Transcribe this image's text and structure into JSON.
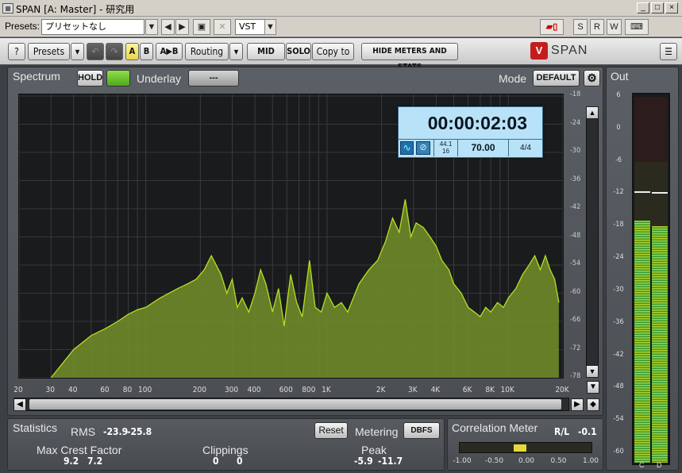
{
  "window": {
    "title": "SPAN [A: Master] - 研究用",
    "min_label": "_",
    "max_label": "□",
    "close_label": "×"
  },
  "host": {
    "presets_label": "Presets:",
    "preset_value": "プリセットなし",
    "vst_label": "VST",
    "s_label": "S",
    "r_label": "R",
    "w_label": "W"
  },
  "toolbar": {
    "help": "?",
    "presets": "Presets",
    "a": "A",
    "b": "B",
    "ab": "A▶B",
    "routing": "Routing",
    "mid": "MID",
    "solo": "SOLO",
    "copy_to": "Copy to",
    "hide_meters": "HIDE METERS AND STATS",
    "brand": "SPAN"
  },
  "spectrum": {
    "title": "Spectrum",
    "hold": "HOLD",
    "underlay_label": "Underlay",
    "underlay_value": "---",
    "mode_label": "Mode",
    "mode_value": "DEFAULT",
    "time": "00:00:02:03",
    "samplerate": "44.1",
    "bitdepth": "16",
    "tempo": "70.00",
    "signature": "4/4",
    "db_ticks": [
      "-18",
      "-24",
      "-30",
      "-36",
      "-42",
      "-48",
      "-54",
      "-60",
      "-66",
      "-72",
      "-78"
    ],
    "freq_ticks": [
      {
        "f": 20,
        "label": "20"
      },
      {
        "f": 30,
        "label": "30"
      },
      {
        "f": 40,
        "label": "40"
      },
      {
        "f": 60,
        "label": "60"
      },
      {
        "f": 80,
        "label": "80"
      },
      {
        "f": 100,
        "label": "100"
      },
      {
        "f": 200,
        "label": "200"
      },
      {
        "f": 300,
        "label": "300"
      },
      {
        "f": 400,
        "label": "400"
      },
      {
        "f": 600,
        "label": "600"
      },
      {
        "f": 800,
        "label": "800"
      },
      {
        "f": 1000,
        "label": "1K"
      },
      {
        "f": 2000,
        "label": "2K"
      },
      {
        "f": 3000,
        "label": "3K"
      },
      {
        "f": 4000,
        "label": "4K"
      },
      {
        "f": 6000,
        "label": "6K"
      },
      {
        "f": 8000,
        "label": "8K"
      },
      {
        "f": 10000,
        "label": "10K"
      },
      {
        "f": 20000,
        "label": "20K"
      }
    ],
    "fill_color": "#6f8a2a",
    "line_color": "#b5e022"
  },
  "chart_data": {
    "type": "area",
    "xscale": "log",
    "xlim": [
      20,
      20000
    ],
    "ylim": [
      -78,
      -18
    ],
    "x": [
      30,
      40,
      50,
      60,
      70,
      80,
      90,
      100,
      120,
      150,
      170,
      190,
      210,
      230,
      260,
      280,
      300,
      320,
      340,
      370,
      400,
      430,
      460,
      500,
      540,
      580,
      630,
      680,
      730,
      800,
      860,
      930,
      1000,
      1100,
      1200,
      1300,
      1500,
      1700,
      1900,
      2100,
      2300,
      2500,
      2700,
      2900,
      3100,
      3400,
      3700,
      4000,
      4300,
      4700,
      5000,
      5500,
      6000,
      6500,
      7000,
      7500,
      8000,
      8700,
      9400,
      10000,
      11000,
      12000,
      13000,
      14000,
      15000,
      16000,
      17000,
      18000,
      19000
    ],
    "values": [
      -78,
      -72,
      -69,
      -67.5,
      -66,
      -64.5,
      -63.5,
      -63,
      -61,
      -59,
      -58,
      -57,
      -55,
      -52,
      -56,
      -60,
      -57,
      -63,
      -61,
      -64,
      -60,
      -55,
      -58,
      -64,
      -59,
      -67,
      -56,
      -62,
      -65,
      -53,
      -63,
      -64,
      -60,
      -63,
      -62,
      -64,
      -58,
      -55,
      -53,
      -49,
      -44,
      -47,
      -40,
      -48,
      -45,
      -46,
      -48,
      -50,
      -53,
      -55,
      -58,
      -60,
      -63,
      -64,
      -65,
      -63,
      -64,
      -62,
      -63,
      -61,
      -59,
      -56,
      -54,
      -52,
      -55,
      -52,
      -55,
      -57,
      -62
    ]
  },
  "stats": {
    "title": "Statistics",
    "rms_label": "RMS",
    "rms_l": "-23.9",
    "rms_r": "-25.8",
    "reset": "Reset",
    "metering_label": "Metering",
    "metering_value": "DBFS",
    "crest_label": "Max Crest Factor",
    "crest_l": "9.2",
    "crest_r": "7.2",
    "clip_label": "Clippings",
    "clip_l": "0",
    "clip_r": "0",
    "peak_label": "Peak",
    "peak_l": "-5.9",
    "peak_r": "-11.7"
  },
  "correlation": {
    "title": "Correlation Meter",
    "mode": "R/L",
    "value": "-0.1",
    "ticks": [
      "-1.00",
      "-0.50",
      "0.00",
      "0.50",
      "1.00"
    ],
    "level": -0.1
  },
  "out": {
    "title": "Out",
    "ticks": [
      "6",
      "0",
      "-6",
      "-12",
      "-18",
      "-24",
      "-30",
      "-36",
      "-42",
      "-48",
      "-54",
      "-60"
    ],
    "channel_l": "C",
    "channel_r": "D",
    "level_l_db": -17,
    "level_r_db": -18,
    "peak_l_db": -11.5,
    "peak_r_db": -11.7
  }
}
